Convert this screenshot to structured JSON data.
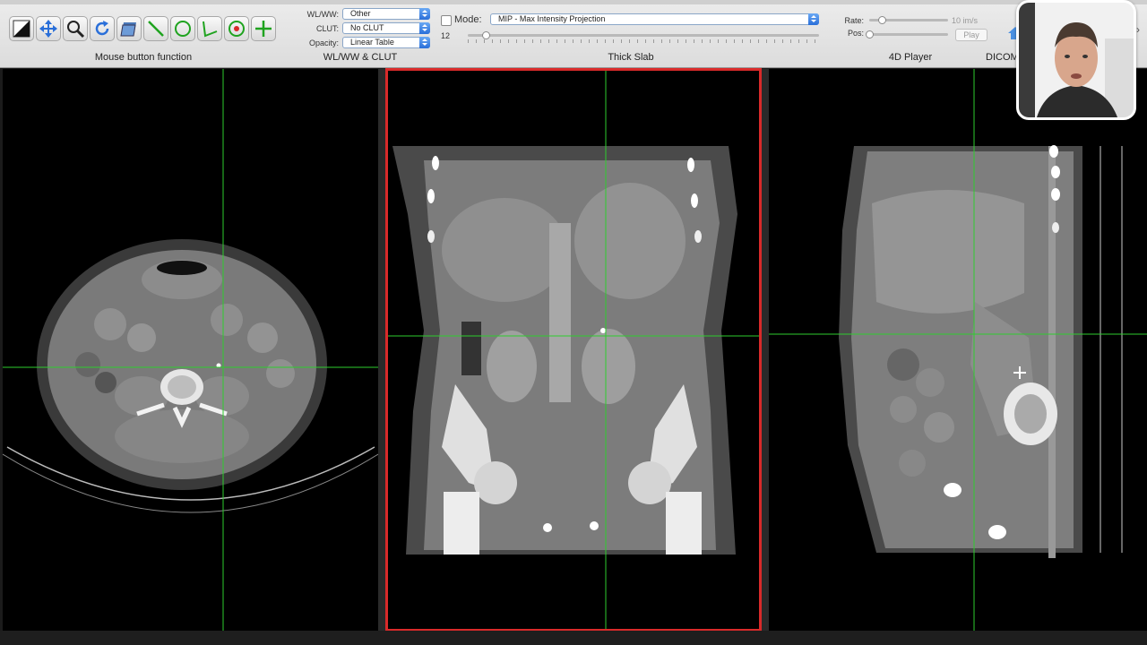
{
  "toolbar": {
    "tools": [
      {
        "icon": "window-level-icon"
      },
      {
        "icon": "move-icon"
      },
      {
        "icon": "zoom-icon"
      },
      {
        "icon": "rotate-icon"
      },
      {
        "icon": "scroll-stack-icon"
      },
      {
        "icon": "length-tool-icon"
      },
      {
        "icon": "oval-roi-icon"
      },
      {
        "icon": "angle-tool-icon"
      },
      {
        "icon": "point-roi-icon"
      },
      {
        "icon": "3d-point-icon"
      }
    ],
    "mouse_section_label": "Mouse button function",
    "wlww": {
      "wlww_label": "WL/WW:",
      "wlww_value": "Other",
      "clut_label": "CLUT:",
      "clut_value": "No CLUT",
      "opacity_label": "Opacity:",
      "opacity_value": "Linear Table",
      "section_label": "WL/WW & CLUT"
    },
    "thick_slab": {
      "mode_label": "Mode:",
      "mode_value": "MIP - Max Intensity Projection",
      "thickness_value": "12",
      "thickness_fraction": 0.05,
      "section_label": "Thick Slab"
    },
    "player": {
      "rate_label": "Rate:",
      "rate_value": "10 im/s",
      "pos_label": "Pos:",
      "play_label": "Play",
      "section_label": "4D Player"
    },
    "dicom_label": "DICOM"
  },
  "viewers": [
    {
      "name": "axial"
    },
    {
      "name": "coronal",
      "active": true
    },
    {
      "name": "sagittal"
    }
  ],
  "colors": {
    "crosshair": "#2ecc2e",
    "active_border": "#d92a2a"
  }
}
